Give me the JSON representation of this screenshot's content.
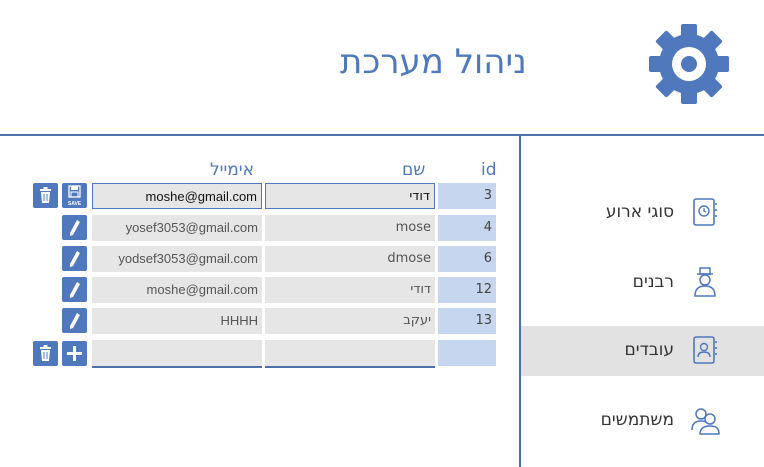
{
  "header": {
    "title": "ניהול מערכת",
    "accent_color": "#4f78bd"
  },
  "sidebar": {
    "items": [
      {
        "label": "סוגי ארוע",
        "icon": "calendar-book-icon"
      },
      {
        "label": "רבנים",
        "icon": "rabbi-icon"
      },
      {
        "label": "עובדים",
        "icon": "employee-book-icon",
        "active": true
      },
      {
        "label": "משתמשים",
        "icon": "users-icon"
      }
    ]
  },
  "table": {
    "headers": {
      "id": "id",
      "name": "שם",
      "email": "אימייל"
    },
    "rows": [
      {
        "id": "3",
        "name": "דודי",
        "email": "moshe@gmail.com",
        "editing": true
      },
      {
        "id": "4",
        "name": "mose",
        "email": "yosef3053@gmail.com"
      },
      {
        "id": "6",
        "name": "dmose",
        "email": "yodsef3053@gmail.com"
      },
      {
        "id": "12",
        "name": "דודי",
        "email": "moshe@gmail.com"
      },
      {
        "id": "13",
        "name": "יעקב",
        "email": "HHHH"
      }
    ],
    "new_row": {
      "id": "",
      "name": "",
      "email": ""
    },
    "save_label": "SAVE"
  }
}
